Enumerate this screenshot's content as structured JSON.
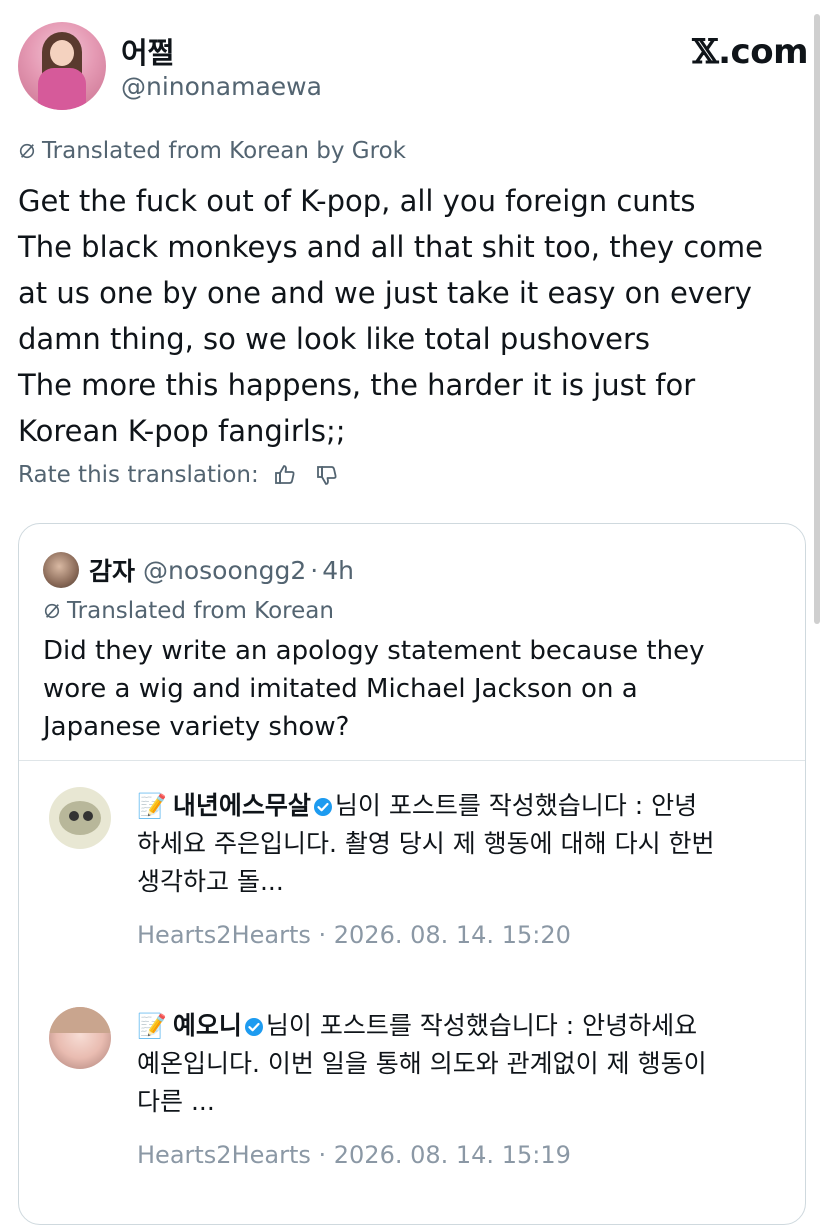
{
  "author": {
    "display_name": "어쩔",
    "handle": "@ninonamaewa"
  },
  "brand": {
    "x_mark": "𝕏",
    "suffix": ".com"
  },
  "post": {
    "translated_label": "Translated from Korean by Grok",
    "lines": [
      "Get the fuck out of K-pop, all you foreign cunts",
      "The black monkeys and all that shit too, they come",
      "at us one by one and we just take it easy on every",
      "damn thing, so we look like total pushovers",
      "The more this happens, the harder it is just for",
      "Korean K-pop fangirls;;"
    ],
    "rate_label": "Rate this translation:"
  },
  "quote": {
    "display_name": "감자",
    "handle": "@nosoongg2",
    "separator": "·",
    "time": "4h",
    "translated_label": "Translated from Korean",
    "lines": [
      "Did they write an apology statement because they",
      "wore a wig and imitated Michael Jackson on a",
      "Japanese variety show?"
    ]
  },
  "embeds": [
    {
      "memo": "📝",
      "username": "내년에스무살",
      "lines": [
        "님이 포스트를 작성했습니다 : 안녕",
        "하세요 주은입니다. 촬영 당시 제 행동에 대해 다시 한번",
        "생각하고 돌..."
      ],
      "meta": "Hearts2Hearts · 2026. 08. 14. 15:20"
    },
    {
      "memo": "📝",
      "username": "예오니",
      "lines": [
        "님이 포스트를 작성했습니다 : 안녕하세요",
        "예온입니다. 이번 일을 통해 의도와 관계없이 제 행동이",
        "다른 ..."
      ],
      "meta": "Hearts2Hearts · 2026. 08. 14. 15:19"
    }
  ],
  "colors": {
    "text": "#0f1419",
    "muted": "#536471",
    "meta": "#8b98a5",
    "verified": "#1d9bf0",
    "border": "#cfd9de"
  },
  "icons": [
    "grok-translate-icon",
    "thumbs-up-icon",
    "thumbs-down-icon",
    "verified-badge-icon",
    "memo-icon"
  ]
}
